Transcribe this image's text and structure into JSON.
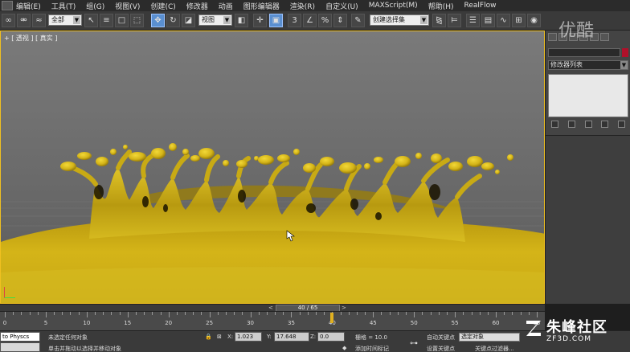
{
  "menu": [
    "编辑(E)",
    "工具(T)",
    "组(G)",
    "视图(V)",
    "创建(C)",
    "修改器",
    "动画",
    "图形编辑器",
    "渲染(R)",
    "自定义(U)",
    "MAXScript(M)",
    "帮助(H)",
    "RealFlow"
  ],
  "toolbar": {
    "selection_filter": "全部",
    "ref_coord": "视图",
    "snap_labels": [
      "3",
      "%"
    ],
    "named_selection": "创建选择集"
  },
  "viewport": {
    "label": "+ [ 透视 ] [ 真实 ]"
  },
  "command_panel": {
    "modifier_list": "修改器列表"
  },
  "timeline": {
    "frame_display": "40 / 65",
    "prev": "<",
    "next": ">",
    "current_frame": 40,
    "total_frames": 65,
    "ticks": [
      "0",
      "5",
      "10",
      "15",
      "20",
      "25",
      "30",
      "35",
      "40",
      "45",
      "50",
      "55",
      "60",
      "65"
    ]
  },
  "status": {
    "script_listener": "to Physcs",
    "selection_status": "未选定任何对象",
    "prompt": "单击并拖动以选择并移动对象",
    "x_label": "X:",
    "x_value": "1.023",
    "y_label": "Y:",
    "y_value": "17.648",
    "z_label": "Z:",
    "z_value": "0.0",
    "grid": "栅格 = 10.0",
    "add_time_tag": "添加时间标记",
    "auto_key": "自动关键点",
    "set_key": "设置关键点",
    "key_filter_select": "选定对象",
    "key_filters": "关键点过滤器..."
  },
  "watermark": {
    "top": "优酷",
    "bottom_main": "朱峰社区",
    "bottom_sub": "ZF3D.COM"
  },
  "colors": {
    "liquid": "#d4b418",
    "liquid_dark": "#8a7008",
    "viewport_border": "#f0c020",
    "active_tool": "#5a8fd0"
  }
}
